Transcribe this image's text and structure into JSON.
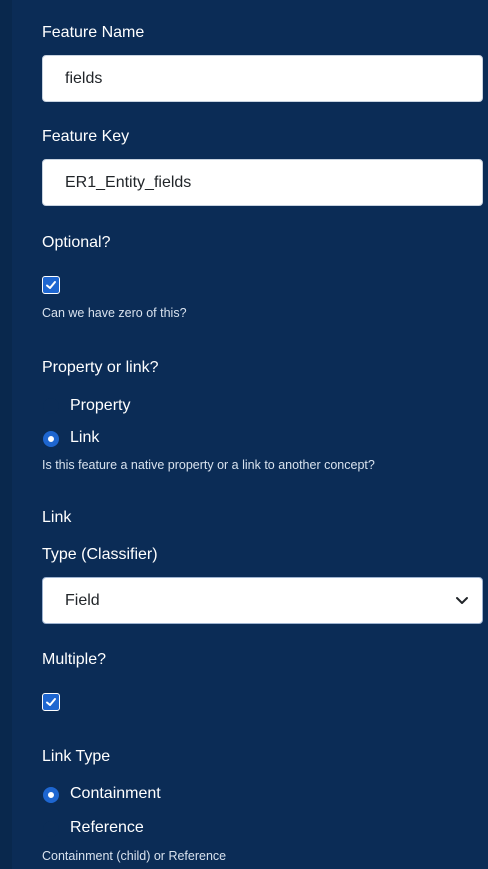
{
  "form": {
    "feature_name": {
      "label": "Feature Name",
      "value": "fields"
    },
    "feature_key": {
      "label": "Feature Key",
      "value": "ER1_Entity_fields"
    },
    "optional": {
      "label": "Optional?",
      "checked": true,
      "help": "Can we have zero of this?"
    },
    "property_or_link": {
      "label": "Property or link?",
      "options": [
        "Property",
        "Link"
      ],
      "selected": "Link",
      "help": "Is this feature a native property or a link to another concept?"
    },
    "link_section": {
      "title": "Link"
    },
    "type_classifier": {
      "label": "Type (Classifier)",
      "value": "Field"
    },
    "multiple": {
      "label": "Multiple?",
      "checked": true
    },
    "link_type": {
      "label": "Link Type",
      "options": [
        "Containment",
        "Reference"
      ],
      "selected": "Containment",
      "help": "Containment (child) or Reference"
    }
  },
  "icons": {
    "check": "check-icon",
    "chevron": "chevron-down-icon"
  },
  "colors": {
    "background": "#0b2c56",
    "accent": "#1e66d0",
    "input_bg": "#ffffff"
  }
}
